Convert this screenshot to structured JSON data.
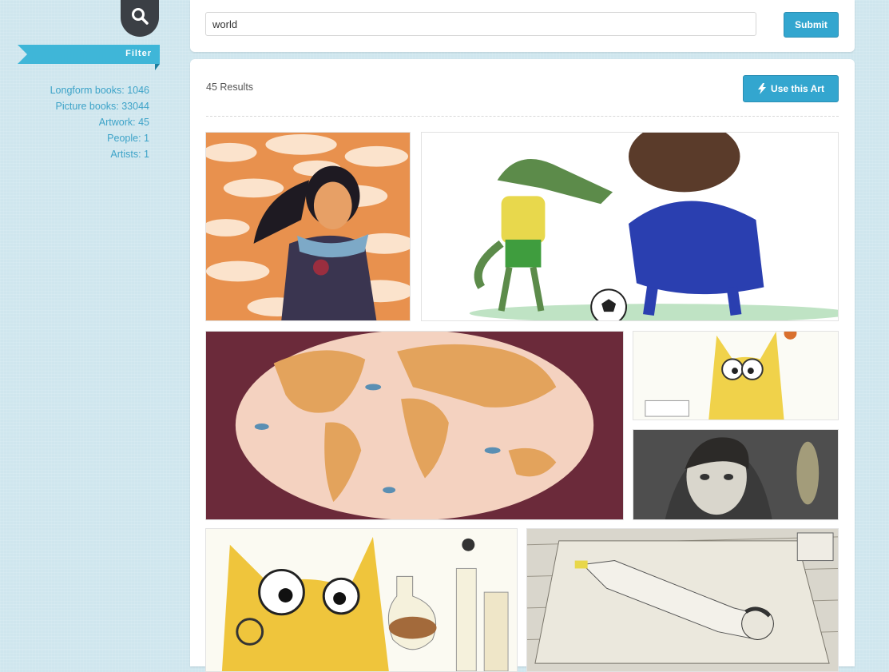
{
  "sidebar": {
    "filter_label": "Filter",
    "filters": [
      {
        "label": "Longform books: 1046"
      },
      {
        "label": "Picture books: 33044"
      },
      {
        "label": "Artwork: 45"
      },
      {
        "label": "People: 1"
      },
      {
        "label": "Artists: 1"
      }
    ]
  },
  "search": {
    "query": "world",
    "submit_label": "Submit"
  },
  "results": {
    "count_label": "45 Results",
    "use_art_label": "Use this Art"
  },
  "colors": {
    "accent": "#33a6cf",
    "link": "#3da3c8",
    "background": "#cfe6ee"
  },
  "icons": [
    "search-icon",
    "lightning-icon"
  ]
}
